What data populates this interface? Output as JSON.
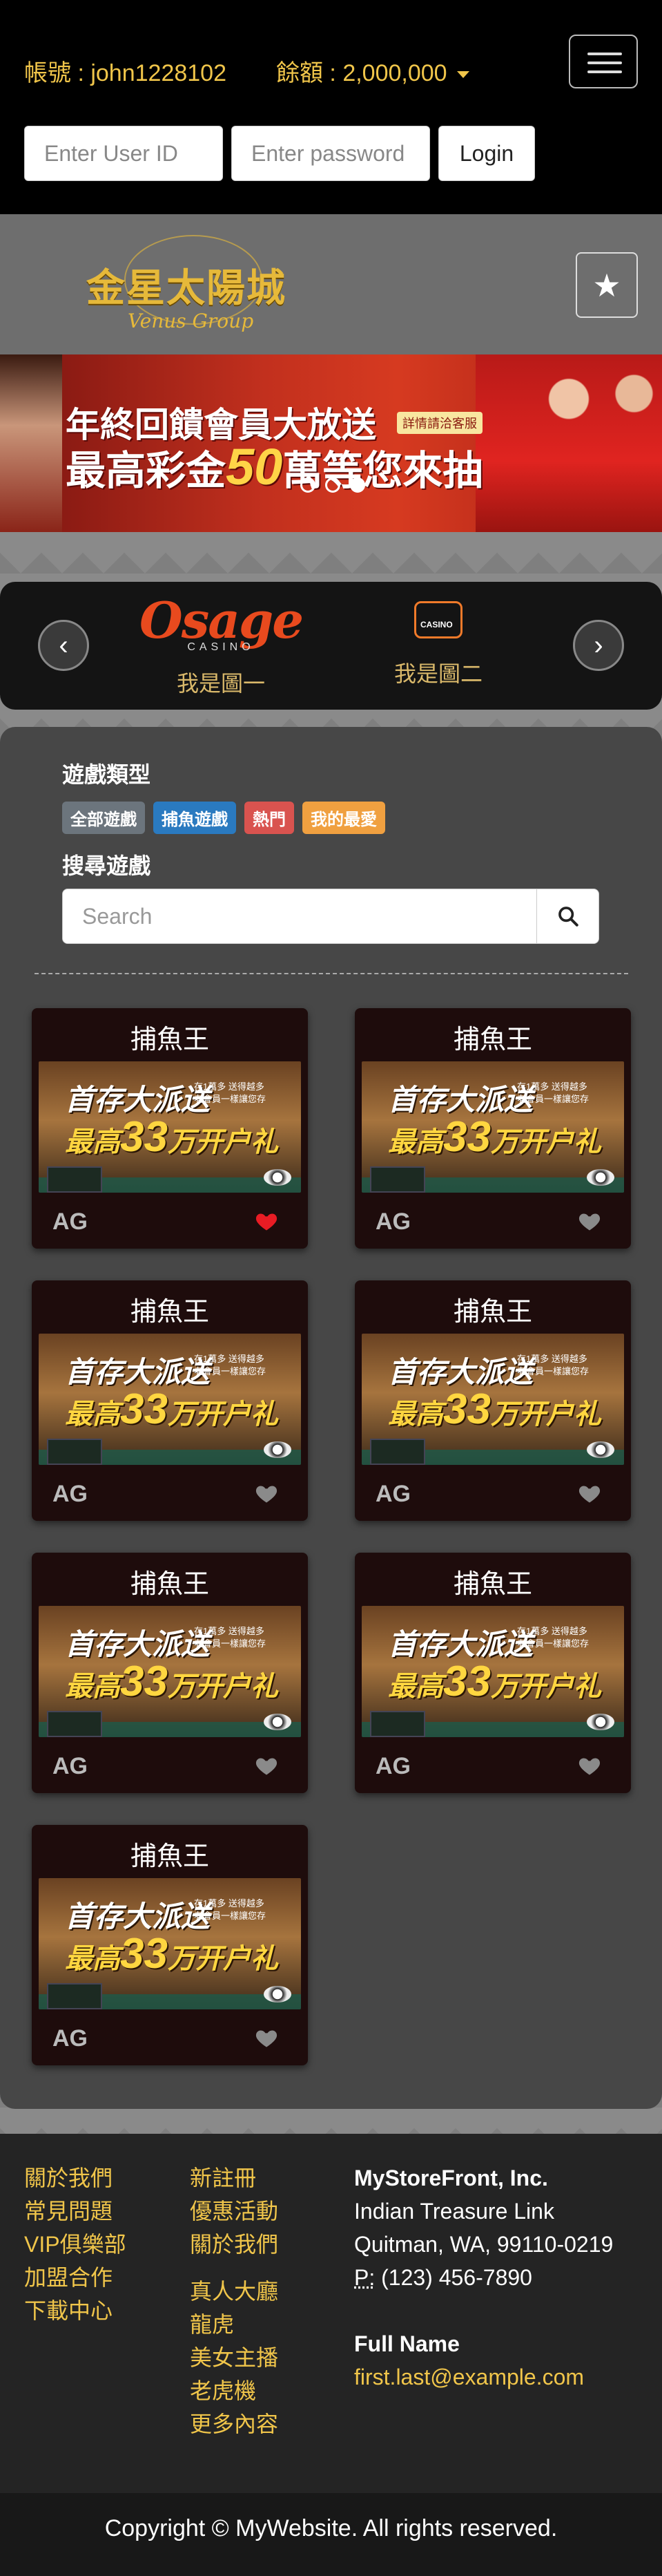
{
  "header": {
    "account_label": "帳號 : john1228102",
    "balance_label": "餘額 : 2,000,000",
    "user_placeholder": "Enter User ID",
    "password_placeholder": "Enter password",
    "login_label": "Login"
  },
  "brand": {
    "logo_main": "金星太陽城",
    "logo_sub": "Venus Group"
  },
  "banner": {
    "line1": "年終回饋會員大放送",
    "line2_pre": "最高彩金",
    "line2_big": "50",
    "line2_post": "萬等您來抽",
    "tag": "詳情請洽客服",
    "slide_count": 3,
    "active_slide": 3
  },
  "providers": {
    "items": [
      {
        "logo": "Osage",
        "logo_sub": "CASINO",
        "label": "我是圖一"
      },
      {
        "logo": "CASINO",
        "label": "我是圖二"
      }
    ],
    "prev_label": "‹",
    "next_label": "›"
  },
  "games": {
    "type_title": "遊戲類型",
    "tags": [
      "全部遊戲",
      "捕魚遊戲",
      "熱門",
      "我的最愛"
    ],
    "search_title": "搜尋遊戲",
    "search_placeholder": "Search",
    "banner_line1": "首存大派送",
    "banner_small": "存1萬多 送得越多\n老會員一樣讓您存",
    "banner_line2_pre": "最高",
    "banner_line2_big": "33",
    "banner_line2_post": "万开户礼金",
    "cards": [
      {
        "title": "捕魚王",
        "provider": "AG",
        "favorite": true
      },
      {
        "title": "捕魚王",
        "provider": "AG",
        "favorite": false
      },
      {
        "title": "捕魚王",
        "provider": "AG",
        "favorite": false
      },
      {
        "title": "捕魚王",
        "provider": "AG",
        "favorite": false
      },
      {
        "title": "捕魚王",
        "provider": "AG",
        "favorite": false
      },
      {
        "title": "捕魚王",
        "provider": "AG",
        "favorite": false
      },
      {
        "title": "捕魚王",
        "provider": "AG",
        "favorite": false
      }
    ]
  },
  "footer": {
    "col1": [
      "關於我們",
      "常見問題",
      "VIP俱樂部",
      "加盟合作",
      "下載中心"
    ],
    "col2a": [
      "新註冊",
      "優惠活動",
      "關於我們"
    ],
    "col2b": [
      "真人大廳",
      "龍虎",
      "美女主播",
      "老虎機",
      "更多內容"
    ],
    "company": "MyStoreFront, Inc.",
    "address1": "Indian Treasure Link",
    "address2": "Quitman, WA, 99110-0219",
    "phone_abbr": "P:",
    "phone": "(123) 456-7890",
    "contact_name": "Full Name",
    "contact_email": "first.last@example.com"
  },
  "copyright": "Copyright © MyWebsite. All rights reserved.",
  "colors": {
    "accent_gold": "#f0c54a",
    "favorite_red": "#e81c24",
    "tag_all": "#6c757d",
    "tag_fishing": "#2a7ac0",
    "tag_hot": "#d9534f",
    "tag_fav": "#f0a040"
  }
}
